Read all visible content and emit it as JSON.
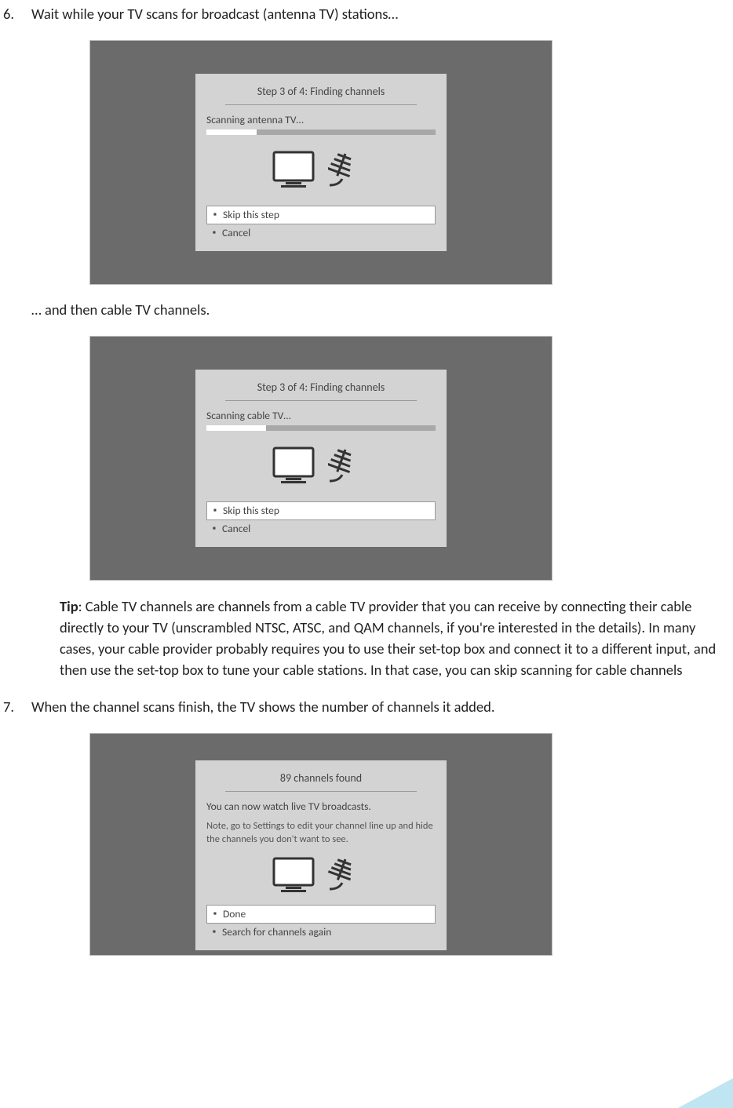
{
  "step6": {
    "num": "6.",
    "text": "Wait while your TV scans for broadcast (antenna TV) stations…",
    "continuation": "… and then cable TV channels."
  },
  "shot1": {
    "title": "Step 3 of 4: Finding channels",
    "scan": "Scanning antenna TV…",
    "skip": "Skip this step",
    "cancel": "Cancel"
  },
  "shot2": {
    "title": "Step 3 of 4: Finding channels",
    "scan": "Scanning cable TV…",
    "skip": "Skip this step",
    "cancel": "Cancel"
  },
  "tip": {
    "label": "Tip",
    "text": ": Cable TV channels are channels from a cable TV provider that you can receive by connecting their cable directly to your TV (unscrambled NTSC, ATSC, and QAM channels, if you're interested in the details). In many cases, your cable provider probably requires you to use their set-top box and connect it to a different input, and then use the set-top box to tune your cable stations. In that case, you can skip scanning for cable channels"
  },
  "step7": {
    "num": "7.",
    "text": "When the channel scans finish, the TV shows the number of channels it added."
  },
  "shot3": {
    "title": "89 channels found",
    "desc": "You can now watch live TV broadcasts.",
    "note": "Note, go to Settings to edit your channel line up and hide the channels you don't want to see.",
    "done": "Done",
    "again": "Search for channels again"
  }
}
